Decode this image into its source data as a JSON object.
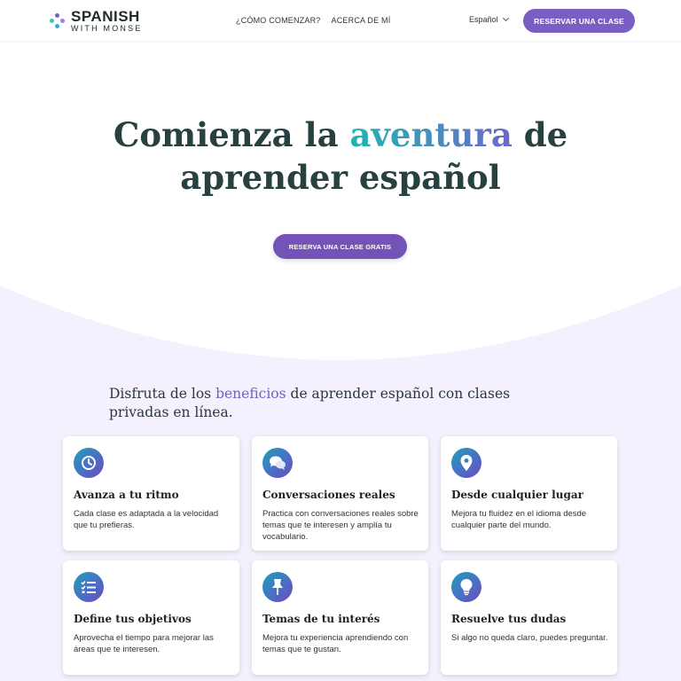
{
  "header": {
    "logo": {
      "line1": "SPANISH",
      "line2": "WITH MONSE"
    },
    "nav": [
      {
        "label": "¿CÓMO COMENZAR?"
      },
      {
        "label": "ACERCA DE MÍ"
      }
    ],
    "language": "Español",
    "cta": "RESERVAR UNA CLASE"
  },
  "hero": {
    "title_part1": "Comienza la",
    "title_accent": "aventura",
    "title_part2": "de",
    "title_line2": "aprender español",
    "cta": "RESERVA UNA CLASE GRATIS"
  },
  "benefits": {
    "heading_part1": "Disfruta de los",
    "heading_accent": "beneficios",
    "heading_part2": "de aprender español con clases privadas en línea.",
    "cards": [
      {
        "title": "Avanza a tu ritmo",
        "desc": "Cada clase es adaptada a la velocidad que tu prefieras.",
        "icon": "clock-icon"
      },
      {
        "title": "Conversaciones reales",
        "desc": "Practica con conversaciones reales sobre temas que te interesen y amplía tu vocabulario.",
        "icon": "chat-icon"
      },
      {
        "title": "Desde cualquier lugar",
        "desc": "Mejora tu fluidez en el idioma desde cualquier parte del mundo.",
        "icon": "location-pin-icon"
      },
      {
        "title": "Define tus objetivos",
        "desc": "Aprovecha el tiempo para mejorar las áreas que te interesen.",
        "icon": "checklist-icon"
      },
      {
        "title": "Temas de tu interés",
        "desc": "Mejora tu experiencia aprendiendo con temas que te gustan.",
        "icon": "pushpin-icon"
      },
      {
        "title": "Resuelve tus dudas",
        "desc": "Si algo no queda claro, puedes preguntar.",
        "icon": "lightbulb-icon"
      }
    ]
  },
  "colors": {
    "primary": "#7b5ec4",
    "teal": "#1fb5b0",
    "heading": "#26413f",
    "section_bg": "#f4f0fd"
  }
}
